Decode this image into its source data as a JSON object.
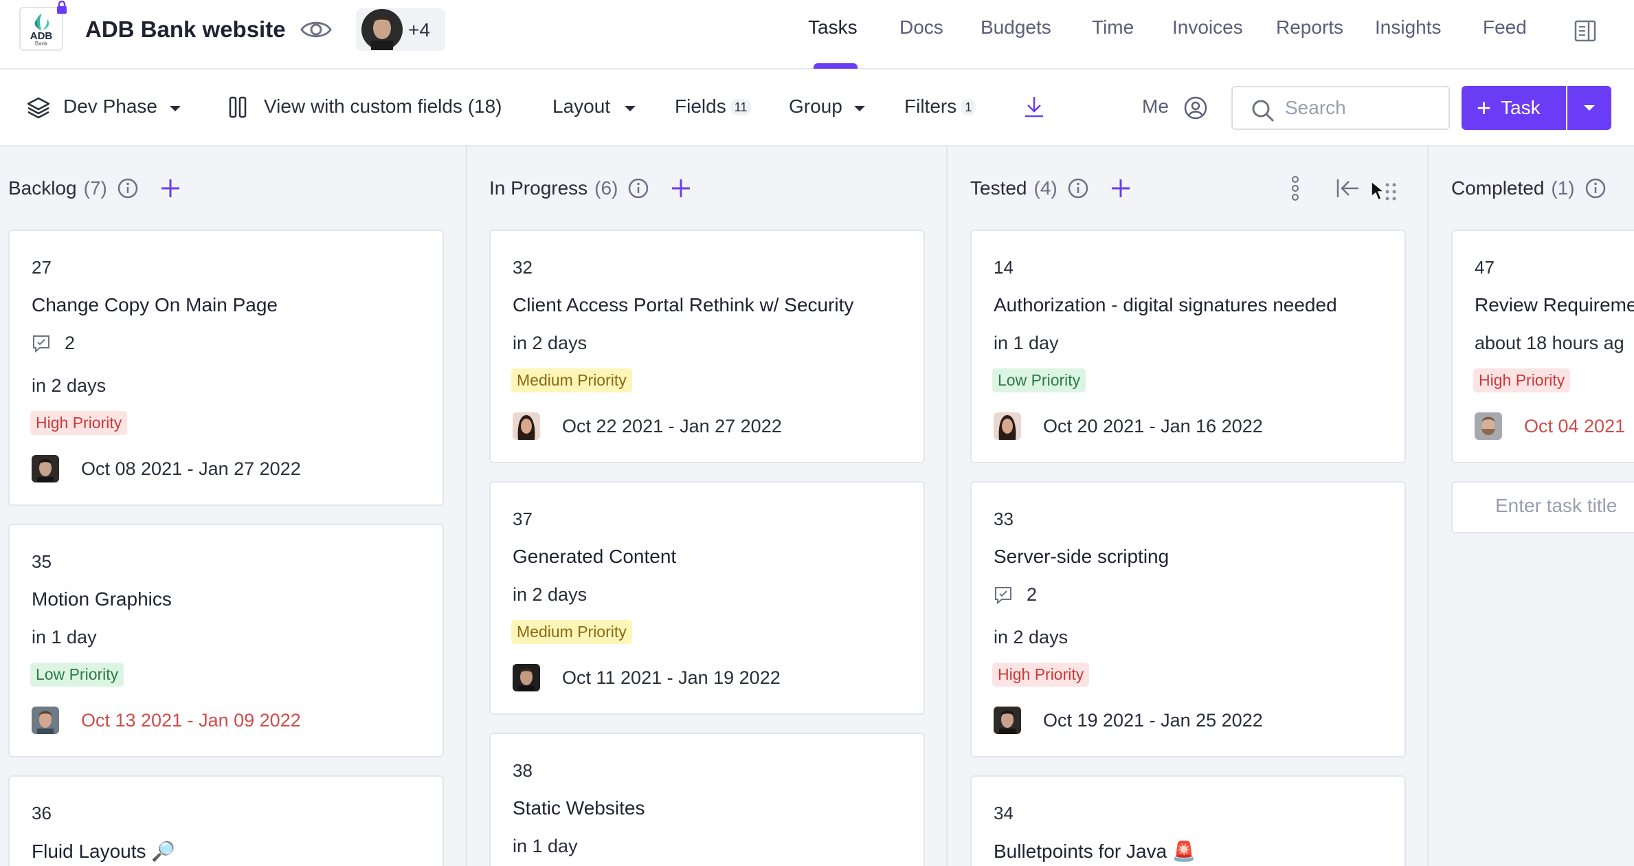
{
  "header": {
    "project_title": "ADB Bank website",
    "logo_text": "ADB",
    "logo_subtext": "Bank",
    "members_more": "+4",
    "nav": [
      {
        "label": "Tasks",
        "active": true
      },
      {
        "label": "Docs"
      },
      {
        "label": "Budgets"
      },
      {
        "label": "Time"
      },
      {
        "label": "Invoices"
      },
      {
        "label": "Reports"
      },
      {
        "label": "Insights"
      },
      {
        "label": "Feed"
      }
    ]
  },
  "toolbar": {
    "phase": "Dev Phase",
    "view": "View with custom fields (18)",
    "layout": "Layout",
    "fields": "Fields",
    "fields_count": "11",
    "group": "Group",
    "filters": "Filters",
    "filters_count": "1",
    "me": "Me",
    "search_placeholder": "Search",
    "task_button": "Task"
  },
  "columns": [
    {
      "name": "Backlog",
      "count": "(7)",
      "cards": [
        {
          "id": "27",
          "title": "Change Copy On Main Page",
          "comments": "2",
          "due": "in 2 days",
          "priority": "High Priority",
          "dates": "Oct 08 2021 - Jan 27 2022"
        },
        {
          "id": "35",
          "title": "Motion Graphics",
          "due": "in 1 day",
          "priority": "Low Priority",
          "dates": "Oct 13 2021 - Jan 09 2022"
        },
        {
          "id": "36",
          "title": "Fluid Layouts 🔎"
        }
      ]
    },
    {
      "name": "In Progress",
      "count": "(6)",
      "cards": [
        {
          "id": "32",
          "title": "Client Access Portal Rethink w/ Security",
          "due": "in 2 days",
          "priority": "Medium Priority",
          "dates": "Oct 22 2021 - Jan 27 2022"
        },
        {
          "id": "37",
          "title": "Generated Content",
          "due": "in 2 days",
          "priority": "Medium Priority",
          "dates": "Oct 11 2021 - Jan 19 2022"
        },
        {
          "id": "38",
          "title": "Static Websites",
          "due": "in 1 day"
        }
      ]
    },
    {
      "name": "Tested",
      "count": "(4)",
      "cards": [
        {
          "id": "14",
          "title": "Authorization - digital signatures needed",
          "due": "in 1 day",
          "priority": "Low Priority",
          "dates": "Oct 20 2021 - Jan 16 2022"
        },
        {
          "id": "33",
          "title": "Server-side scripting",
          "comments": "2",
          "due": "in 2 days",
          "priority": "High Priority",
          "dates": "Oct 19 2021 - Jan 25 2022"
        },
        {
          "id": "34",
          "title": "Bulletpoints for Java 🚨"
        }
      ]
    },
    {
      "name": "Completed",
      "count": "(1)",
      "cards": [
        {
          "id": "47",
          "title": "Review Requireme",
          "due": "about 18 hours ag",
          "priority": "High Priority",
          "dates": "Oct 04 2021"
        }
      ],
      "enter_task_placeholder": "Enter task title"
    }
  ],
  "colors": {
    "accent": "#6a3cf5",
    "high_bg": "#fde4e4",
    "high_fg": "#c83a3a",
    "medium_bg": "#fdf6b8",
    "medium_fg": "#8a6a12",
    "low_bg": "#dcf5e3",
    "low_fg": "#2c7a45",
    "overdue": "#d24b4b"
  }
}
